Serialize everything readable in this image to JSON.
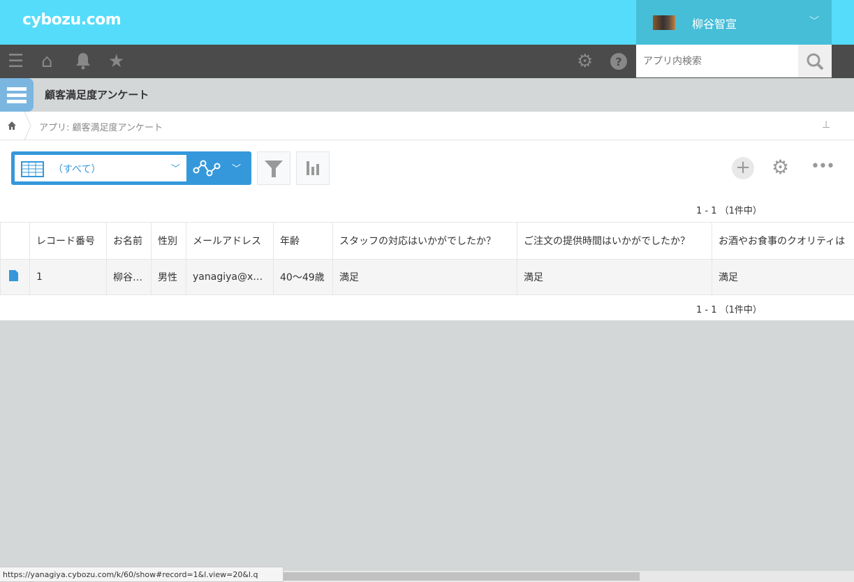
{
  "header": {
    "logo": "cybozu.com",
    "user_name": "柳谷智宣",
    "search_placeholder": "アプリ内検索"
  },
  "app": {
    "title": "顧客満足度アンケート",
    "breadcrumb": "アプリ: 顧客満足度アンケート"
  },
  "toolbar": {
    "view_name": "（すべて）"
  },
  "pagination": {
    "top": "1 - 1 （1件中）",
    "bottom": "1 - 1 （1件中）"
  },
  "table": {
    "columns": [
      "レコード番号",
      "お名前",
      "性別",
      "メールアドレス",
      "年齢",
      "スタッフの対応はいかがでしたか？",
      "ご注文の提供時間はいかがでしたか？",
      "お酒やお食事のクオリティは"
    ],
    "rows": [
      [
        "1",
        "柳谷…",
        "男性",
        "yanagiya@x…",
        "40〜49歳",
        "満足",
        "満足",
        "満足"
      ]
    ]
  },
  "status_bar": {
    "url": "https://yanagiya.cybozu.com/k/60/show#record=1&l.view=20&l.q"
  },
  "colors": {
    "topbar": "#55dcfa",
    "navbar": "#4b4b4b",
    "accent": "#3498db"
  }
}
